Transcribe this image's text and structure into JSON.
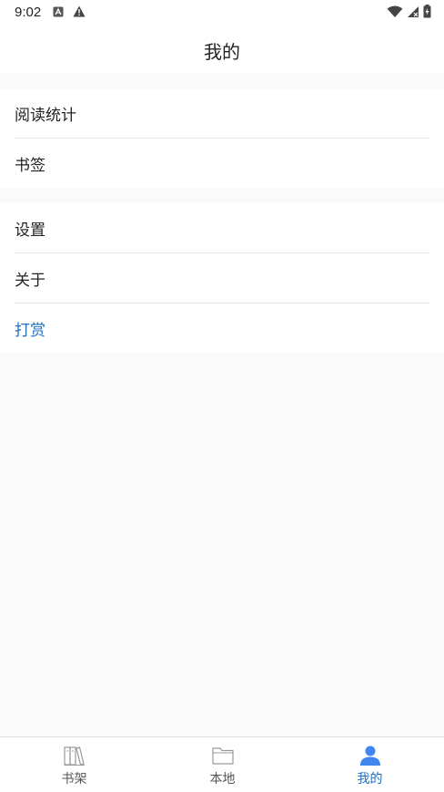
{
  "status_bar": {
    "time": "9:02",
    "left_icons": [
      "a-badge-icon",
      "warning-icon"
    ],
    "right_icons": [
      "wifi-icon",
      "signal-icon",
      "battery-icon"
    ]
  },
  "header": {
    "title": "我的"
  },
  "menu": {
    "group1": [
      {
        "label": "阅读统计"
      },
      {
        "label": "书签"
      }
    ],
    "group2": [
      {
        "label": "设置"
      },
      {
        "label": "关于"
      },
      {
        "label": "打赏"
      }
    ]
  },
  "bottom_nav": {
    "items": [
      {
        "label": "书架",
        "icon": "bookshelf-icon",
        "active": false
      },
      {
        "label": "本地",
        "icon": "folder-icon",
        "active": false
      },
      {
        "label": "我的",
        "icon": "profile-icon",
        "active": true
      }
    ]
  },
  "colors": {
    "accent": "#1f6fbf",
    "background": "#fafafa",
    "surface": "#ffffff",
    "divider": "#e6e6e6"
  }
}
